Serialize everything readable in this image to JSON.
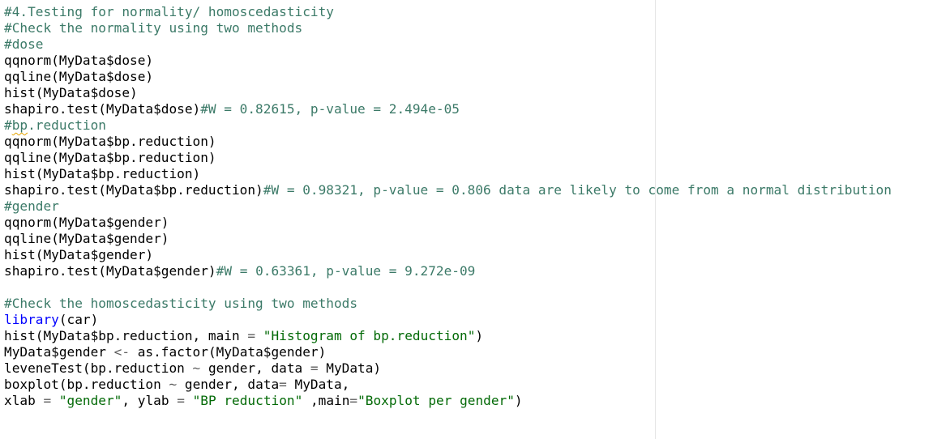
{
  "editor": {
    "lines": [
      [
        {
          "t": "#4.Testing for normality/ homoscedasticity",
          "c": "comment"
        }
      ],
      [
        {
          "t": "#Check the normality using two methods",
          "c": "comment"
        }
      ],
      [
        {
          "t": "#dose",
          "c": "comment"
        }
      ],
      [
        {
          "t": "qqnorm(MyData$dose)",
          "c": "plain"
        }
      ],
      [
        {
          "t": "qqline(MyData$dose)",
          "c": "plain"
        }
      ],
      [
        {
          "t": "hist(MyData$dose)",
          "c": "plain"
        }
      ],
      [
        {
          "t": "shapiro.test(MyData$dose)",
          "c": "plain"
        },
        {
          "t": "#W = 0.82615, p-value = 2.494e-05",
          "c": "comment"
        }
      ],
      [
        {
          "t": "#",
          "c": "comment"
        },
        {
          "t": "bp",
          "c": "comment squiggle"
        },
        {
          "t": ".reduction",
          "c": "comment"
        }
      ],
      [
        {
          "t": "qqnorm(MyData$bp.reduction)",
          "c": "plain"
        }
      ],
      [
        {
          "t": "qqline(MyData$bp.reduction)",
          "c": "plain"
        }
      ],
      [
        {
          "t": "hist(MyData$bp.reduction)",
          "c": "plain"
        }
      ],
      [
        {
          "t": "shapiro.test(MyData$bp.reduction)",
          "c": "plain"
        },
        {
          "t": "#W = 0.98321, p-value = 0.806 data are likely to come from a normal distribution",
          "c": "comment"
        }
      ],
      [
        {
          "t": "#gender",
          "c": "comment"
        }
      ],
      [
        {
          "t": "qqnorm(MyData$gender)",
          "c": "plain"
        }
      ],
      [
        {
          "t": "qqline(MyData$gender)",
          "c": "plain"
        }
      ],
      [
        {
          "t": "hist(MyData$gender)",
          "c": "plain"
        }
      ],
      [
        {
          "t": "shapiro.test(MyData$gender)",
          "c": "plain"
        },
        {
          "t": "#W = 0.63361, p-value = 9.272e-09",
          "c": "comment"
        }
      ],
      [],
      [
        {
          "t": "#Check the homoscedasticity using two methods",
          "c": "comment"
        }
      ],
      [
        {
          "t": "library",
          "c": "fn"
        },
        {
          "t": "(car)",
          "c": "plain"
        }
      ],
      [
        {
          "t": "hist(MyData$bp.reduction, main ",
          "c": "plain"
        },
        {
          "t": "=",
          "c": "op"
        },
        {
          "t": " ",
          "c": "plain"
        },
        {
          "t": "\"Histogram of bp.reduction\"",
          "c": "str"
        },
        {
          "t": ")",
          "c": "plain"
        }
      ],
      [
        {
          "t": "MyData$gender ",
          "c": "plain"
        },
        {
          "t": "<-",
          "c": "op"
        },
        {
          "t": " as.factor(MyData$gender)",
          "c": "plain"
        }
      ],
      [
        {
          "t": "leveneTest(bp.reduction ",
          "c": "plain"
        },
        {
          "t": "~",
          "c": "op"
        },
        {
          "t": " gender, data ",
          "c": "plain"
        },
        {
          "t": "=",
          "c": "op"
        },
        {
          "t": " MyData)",
          "c": "plain"
        }
      ],
      [
        {
          "t": "boxplot(bp.reduction ",
          "c": "plain"
        },
        {
          "t": "~",
          "c": "op"
        },
        {
          "t": " gender, data",
          "c": "plain"
        },
        {
          "t": "=",
          "c": "op"
        },
        {
          "t": " MyData,",
          "c": "plain"
        }
      ],
      [
        {
          "t": "xlab ",
          "c": "plain"
        },
        {
          "t": "=",
          "c": "op"
        },
        {
          "t": " ",
          "c": "plain"
        },
        {
          "t": "\"gender\"",
          "c": "str"
        },
        {
          "t": ", ylab ",
          "c": "plain"
        },
        {
          "t": "=",
          "c": "op"
        },
        {
          "t": " ",
          "c": "plain"
        },
        {
          "t": "\"BP reduction\"",
          "c": "str"
        },
        {
          "t": " ,main",
          "c": "plain"
        },
        {
          "t": "=",
          "c": "op"
        },
        {
          "t": "\"Boxplot per gender\"",
          "c": "str"
        },
        {
          "t": ")",
          "c": "plain"
        }
      ]
    ]
  }
}
